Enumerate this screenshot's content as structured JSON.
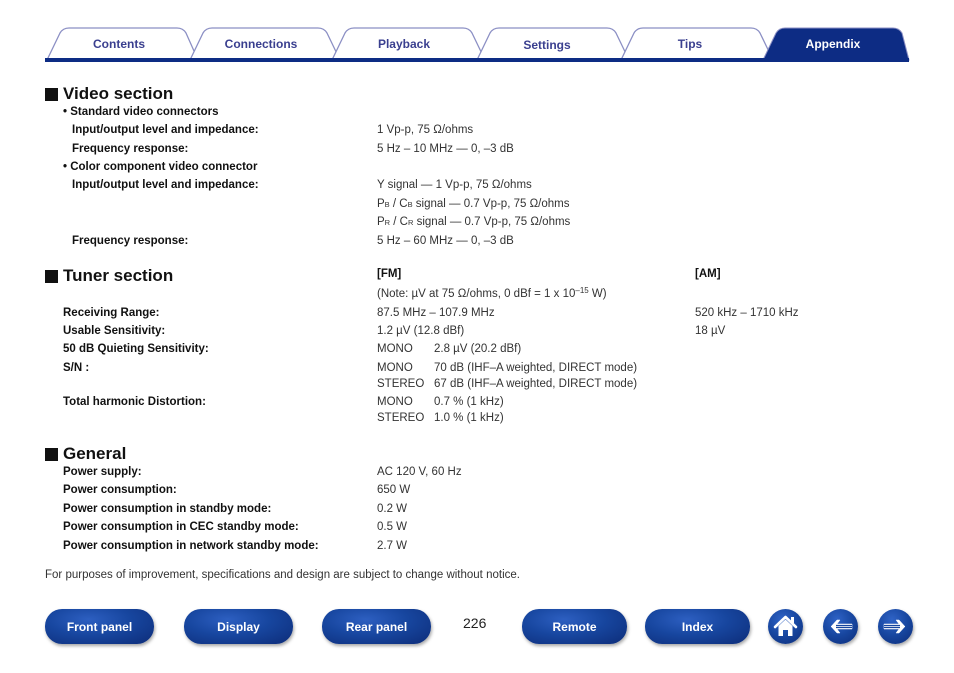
{
  "tabs": [
    {
      "label": "Contents",
      "active": false
    },
    {
      "label": "Connections",
      "active": false
    },
    {
      "label": "Playback",
      "active": false
    },
    {
      "label": "Settings",
      "active": false
    },
    {
      "label": "Tips",
      "active": false
    },
    {
      "label": "Appendix",
      "active": true
    }
  ],
  "colors": {
    "brand_blue": "#0d2c84",
    "tab_text": "#3a3f8f",
    "tab_border": "#8b8fc4"
  },
  "video": {
    "title": "Video section",
    "standard": {
      "heading": "• Standard video connectors",
      "io_label": "Input/output level and impedance:",
      "io_value": "1 Vp-p, 75 Ω/ohms",
      "freq_label": "Frequency response:",
      "freq_value": "5 Hz – 10 MHz — 0, –3 dB"
    },
    "component": {
      "heading": "• Color component video connector",
      "io_label": "Input/output level and impedance:",
      "y_value": "Y signal — 1 Vp-p, 75 Ω/ohms",
      "pb_main": "P",
      "pb_sub": "B",
      "pb_sep": " / C",
      "pb_sub2": "B",
      "pb_rest": " signal — 0.7 Vp-p, 75 Ω/ohms",
      "pr_main": "P",
      "pr_sub": "R",
      "pr_sep": " / C",
      "pr_sub2": "R",
      "pr_rest": " signal — 0.7 Vp-p, 75 Ω/ohms",
      "freq_label": "Frequency response:",
      "freq_value": "5 Hz – 60 MHz — 0, –3 dB"
    }
  },
  "tuner": {
    "title": "Tuner section",
    "fm_header": "[FM]",
    "am_header": "[AM]",
    "note_prefix": "(Note: µV at 75 Ω/ohms, 0 dBf = 1 x 10",
    "note_exp": "–15",
    "note_suffix": " W)",
    "rows": {
      "range": {
        "label": "Receiving Range:",
        "fm": "87.5 MHz – 107.9 MHz",
        "am": "520 kHz – 1710 kHz"
      },
      "sensitivity": {
        "label": "Usable Sensitivity:",
        "fm": "1.2 µV (12.8 dBf)",
        "am": "18 µV"
      },
      "quieting": {
        "label": "50 dB Quieting Sensitivity:",
        "mode": "MONO",
        "fm": "2.8 µV (20.2 dBf)"
      },
      "sn": {
        "label": "S/N :",
        "mono_mode": "MONO",
        "mono": "70 dB (IHF–A weighted, DIRECT mode)",
        "stereo_mode": "STEREO",
        "stereo": "67 dB (IHF–A weighted, DIRECT mode)"
      },
      "thd": {
        "label": "Total harmonic Distortion:",
        "mono_mode": "MONO",
        "mono": "0.7 % (1 kHz)",
        "stereo_mode": "STEREO",
        "stereo": "1.0 % (1 kHz)"
      }
    }
  },
  "general": {
    "title": "General",
    "rows": [
      {
        "label": "Power supply:",
        "value": "AC 120 V, 60 Hz"
      },
      {
        "label": "Power consumption:",
        "value": "650 W"
      },
      {
        "label": "Power consumption in standby mode:",
        "value": "0.2 W"
      },
      {
        "label": "Power consumption in CEC standby mode:",
        "value": "0.5 W"
      },
      {
        "label": "Power consumption in network standby mode:",
        "value": "2.7 W"
      }
    ]
  },
  "footnote": "For purposes of improvement, specifications and design are subject to change without notice.",
  "bottom_nav": {
    "buttons": [
      "Front panel",
      "Display",
      "Rear panel",
      "Remote",
      "Index"
    ],
    "page_number": "226",
    "icons": [
      "home-icon",
      "arrow-left-icon",
      "arrow-right-icon"
    ]
  }
}
